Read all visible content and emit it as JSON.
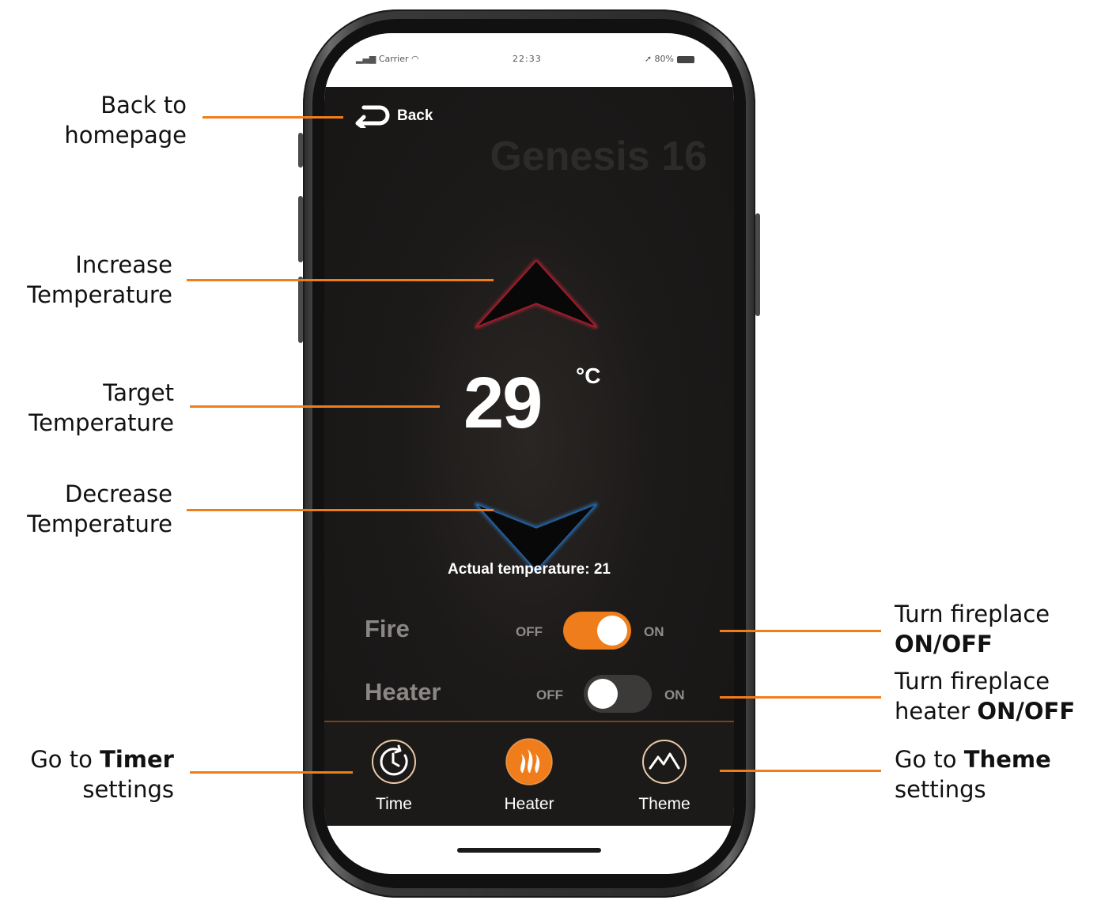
{
  "status_bar": {
    "carrier": "Carrier",
    "time": "22:33",
    "battery": "80%"
  },
  "app": {
    "back_label": "Back",
    "title": "Genesis 16",
    "target_temperature": "29",
    "temperature_unit": "°C",
    "actual_temperature": "Actual temperature: 21",
    "fire": {
      "label": "Fire",
      "off_label": "OFF",
      "on_label": "ON",
      "state": "on"
    },
    "heater": {
      "label": "Heater",
      "off_label": "OFF",
      "on_label": "ON",
      "state": "off"
    },
    "tabs": [
      {
        "label": "Time",
        "icon": "clock-icon",
        "active": false
      },
      {
        "label": "Heater",
        "icon": "flame-icon",
        "active": true
      },
      {
        "label": "Theme",
        "icon": "mountain-icon",
        "active": false
      }
    ]
  },
  "annotations": {
    "back": {
      "line1": "Back to",
      "line2": "homepage"
    },
    "increase": {
      "line1": "Increase",
      "line2": "Temperature"
    },
    "target": {
      "line1": "Target",
      "line2": "Temperature"
    },
    "decrease": {
      "line1": "Decrease",
      "line2": "Temperature"
    },
    "timer": {
      "pre": "Go to ",
      "bold": "Timer",
      "line2": "settings"
    },
    "fire": {
      "line1": "Turn fireplace",
      "bold": "ON/OFF"
    },
    "heater": {
      "line1": "Turn fireplace",
      "pre2": "heater ",
      "bold": "ON/OFF"
    },
    "theme": {
      "pre": "Go to ",
      "bold": "Theme",
      "line2": "settings"
    }
  },
  "colors": {
    "accent": "#f07d1b",
    "up_arrow_glow": "#d0263a",
    "down_arrow_glow": "#2f7fd0",
    "background": "#1c1a19"
  }
}
